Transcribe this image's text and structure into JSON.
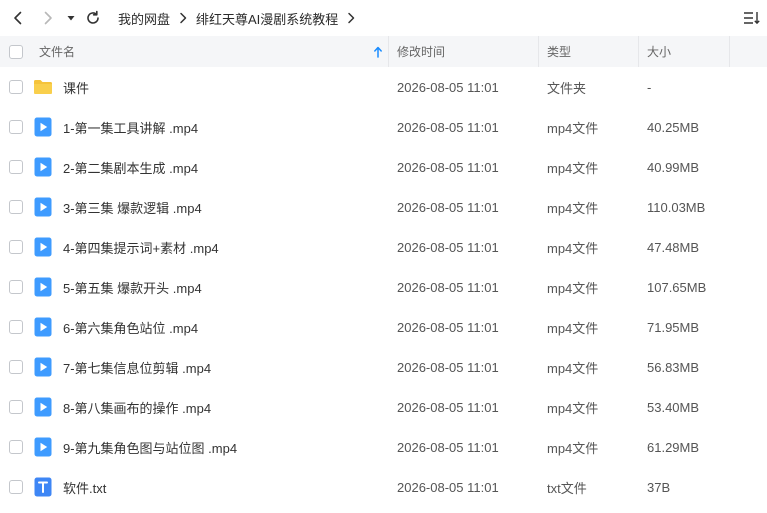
{
  "toolbar": {
    "breadcrumb": [
      "我的网盘",
      "绯红天尊AI漫剧系统教程"
    ],
    "icons": {
      "back": "back-arrow-icon",
      "forward": "forward-arrow-icon",
      "history": "dropdown-triangle-icon",
      "refresh": "refresh-icon",
      "separator": "chevron-right-icon",
      "view": "list-view-icon"
    }
  },
  "header": {
    "name": "文件名",
    "modified": "修改时间",
    "type": "类型",
    "size": "大小",
    "sort_icon": "sort-arrow-up-icon"
  },
  "colors": {
    "accent": "#1a8cff",
    "folder": "#f5c33b",
    "video": "#3e9bff",
    "text_file": "#3e86f5",
    "header_bg": "#f5f6f8"
  },
  "files": [
    {
      "name": "课件",
      "modified": "2026-08-05 11:01",
      "type": "文件夹",
      "size": "-",
      "icon": "folder"
    },
    {
      "name": "1-第一集工具讲解 .mp4",
      "modified": "2026-08-05 11:01",
      "type": "mp4文件",
      "size": "40.25MB",
      "icon": "video"
    },
    {
      "name": "2-第二集剧本生成 .mp4",
      "modified": "2026-08-05 11:01",
      "type": "mp4文件",
      "size": "40.99MB",
      "icon": "video"
    },
    {
      "name": "3-第三集 爆款逻辑 .mp4",
      "modified": "2026-08-05 11:01",
      "type": "mp4文件",
      "size": "110.03MB",
      "icon": "video"
    },
    {
      "name": "4-第四集提示词+素材 .mp4",
      "modified": "2026-08-05 11:01",
      "type": "mp4文件",
      "size": "47.48MB",
      "icon": "video"
    },
    {
      "name": "5-第五集 爆款开头 .mp4",
      "modified": "2026-08-05 11:01",
      "type": "mp4文件",
      "size": "107.65MB",
      "icon": "video"
    },
    {
      "name": "6-第六集角色站位 .mp4",
      "modified": "2026-08-05 11:01",
      "type": "mp4文件",
      "size": "71.95MB",
      "icon": "video"
    },
    {
      "name": "7-第七集信息位剪辑 .mp4",
      "modified": "2026-08-05 11:01",
      "type": "mp4文件",
      "size": "56.83MB",
      "icon": "video"
    },
    {
      "name": "8-第八集画布的操作 .mp4",
      "modified": "2026-08-05 11:01",
      "type": "mp4文件",
      "size": "53.40MB",
      "icon": "video"
    },
    {
      "name": "9-第九集角色图与站位图 .mp4",
      "modified": "2026-08-05 11:01",
      "type": "mp4文件",
      "size": "61.29MB",
      "icon": "video"
    },
    {
      "name": "软件.txt",
      "modified": "2026-08-05 11:01",
      "type": "txt文件",
      "size": "37B",
      "icon": "text"
    }
  ]
}
